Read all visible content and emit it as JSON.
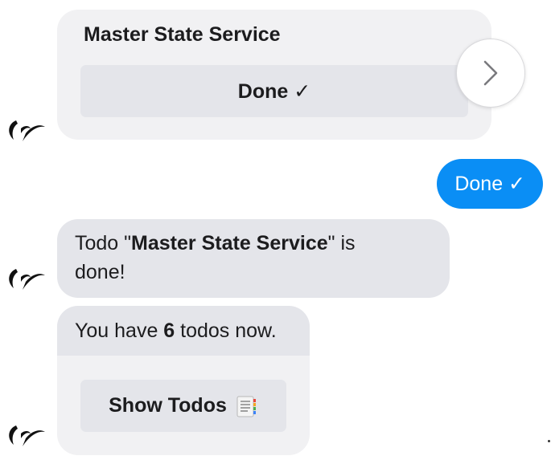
{
  "card1": {
    "title": "Master State Service",
    "button_label": "Done ✓",
    "next_icon": "chevron-right-icon"
  },
  "outgoing": {
    "text": "Done ✓",
    "color": "#0a8ef5"
  },
  "done_message": {
    "prefix": "Todo \"",
    "todo_name": "Master State Service",
    "suffix_line1": "\" is",
    "line2": "done!"
  },
  "count_card": {
    "prefix": "You have ",
    "count": "6",
    "suffix": " todos now.",
    "button_label": "Show Todos",
    "button_icon": "notepad-icon"
  },
  "avatar_icon": "bot-logo-icon"
}
